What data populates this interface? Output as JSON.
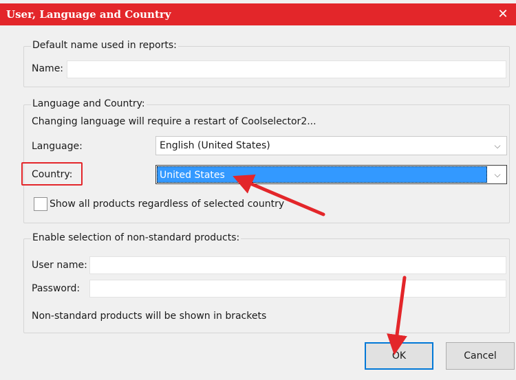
{
  "dialog": {
    "title": "User, Language and Country",
    "close_glyph": "✕"
  },
  "report_group": {
    "legend": "Default name used in reports:",
    "name_label": "Name:",
    "name_value": ""
  },
  "language_group": {
    "legend": "Language and Country:",
    "restart_note": "Changing language will require a restart of Coolselector2...",
    "language_label": "Language:",
    "language_value": "English (United States)",
    "country_label": "Country:",
    "country_value": "United States",
    "show_all_label": "Show all products regardless of selected country",
    "show_all_checked": false
  },
  "nonstandard_group": {
    "legend": "Enable selection of non-standard products:",
    "username_label": "User name:",
    "username_value": "",
    "password_label": "Password:",
    "password_value": "",
    "note": "Non-standard products will be shown in brackets"
  },
  "buttons": {
    "ok_label": "OK",
    "cancel_label": "Cancel"
  },
  "icons": {
    "dropdown": "chevron-down-icon",
    "close": "close-icon"
  },
  "colors": {
    "title_bar": "#e3262a",
    "annotation": "#e3262a",
    "selection": "#3399ff",
    "default_button_border": "#0078d7"
  }
}
